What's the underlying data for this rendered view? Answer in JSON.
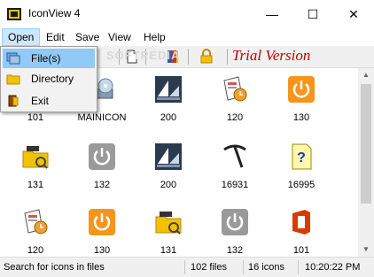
{
  "window": {
    "title": "IconView 4",
    "minimize_glyph": "—",
    "maximize_glyph": "☐",
    "close_glyph": "✕"
  },
  "menubar": {
    "items": [
      "Open",
      "Edit",
      "Save",
      "View",
      "Help"
    ],
    "active": "Open"
  },
  "open_menu": {
    "items": [
      {
        "label": "File(s)",
        "icon": "files-icon",
        "highlighted": true
      },
      {
        "label": "Directory",
        "icon": "folder-icon",
        "highlighted": false
      },
      {
        "label": "Exit",
        "icon": "exit-door-icon",
        "highlighted": false
      }
    ]
  },
  "toolbar": {
    "trial_text": "Trial Version",
    "buttons": [
      "new-page-icon",
      "book-icon",
      "lock-icon"
    ]
  },
  "watermark": "SOFTPEDIA",
  "icons": [
    {
      "label": "101",
      "icon": "office-icon"
    },
    {
      "label": "MAINICON",
      "icon": "cd-drive-icon"
    },
    {
      "label": "200",
      "icon": "sail-icon"
    },
    {
      "label": "120",
      "icon": "document-clock-icon"
    },
    {
      "label": "130",
      "icon": "power-orange-icon"
    },
    {
      "label": "131",
      "icon": "folder-clapper-icon"
    },
    {
      "label": "132",
      "icon": "power-gray-icon"
    },
    {
      "label": "200",
      "icon": "sail-icon"
    },
    {
      "label": "16931",
      "icon": "pickaxe-icon"
    },
    {
      "label": "16995",
      "icon": "question-doc-icon"
    },
    {
      "label": "120",
      "icon": "document-clock-icon"
    },
    {
      "label": "130",
      "icon": "power-orange-icon"
    },
    {
      "label": "131",
      "icon": "folder-clapper-icon"
    },
    {
      "label": "132",
      "icon": "power-gray-icon"
    },
    {
      "label": "101",
      "icon": "office-icon"
    }
  ],
  "statusbar": {
    "hint": "Search for icons in files",
    "files": "102 files",
    "icons": "16 icons",
    "time": "10:20:22 PM"
  },
  "colors": {
    "accent": "#91c9f7",
    "trial": "#c00000",
    "office_red": "#d83b01",
    "power_orange": "#f7941d"
  }
}
